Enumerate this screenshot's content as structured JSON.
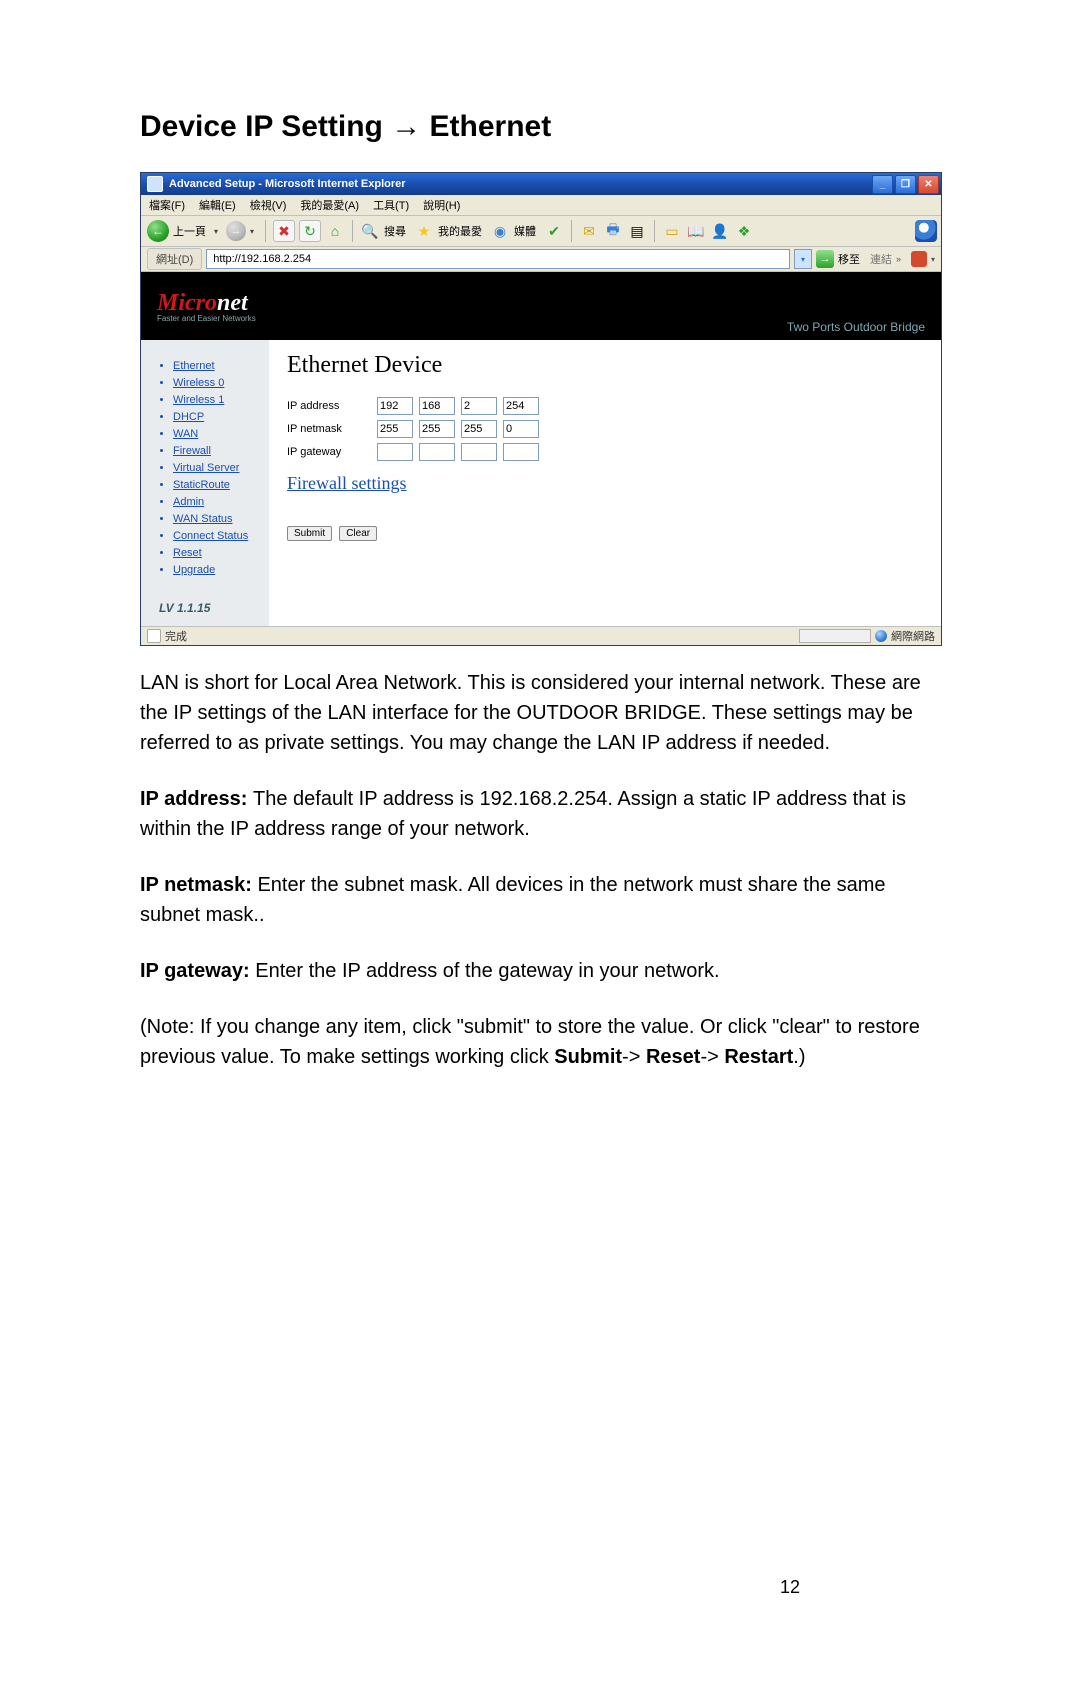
{
  "doc": {
    "heading": "Device IP Setting → Ethernet",
    "para1": "LAN is short for Local Area Network. This is considered your internal network. These are the IP settings of the LAN interface for the OUTDOOR BRIDGE. These settings may be referred to as private settings. You may change the LAN IP address if needed.",
    "ip_addr_lead": "IP address: ",
    "ip_addr_body": "The default IP address is 192.168.2.254. Assign a static IP address that is within the IP address range of your network.",
    "ip_mask_lead": "IP netmask: ",
    "ip_mask_body": "Enter the subnet mask. All devices in the network must share the same subnet mask..",
    "ip_gw_lead": "IP gateway: ",
    "ip_gw_body": "Enter the IP address of the gateway in your network.",
    "note_a": "(Note: If you change any item, click \"submit\" to store the value. Or click \"clear\" to restore previous value. To make settings working click ",
    "note_submit": "Submit",
    "note_b": "-> ",
    "note_reset": "Reset",
    "note_c": "-> ",
    "note_restart": "Restart",
    "note_d": ".)",
    "page_number": "12"
  },
  "ie": {
    "title": "Advanced Setup - Microsoft Internet Explorer",
    "menus": [
      "檔案(F)",
      "編輯(E)",
      "檢視(V)",
      "我的最愛(A)",
      "工具(T)",
      "說明(H)"
    ],
    "back_label": "上一頁",
    "search_label": "搜尋",
    "fav_label": "我的最愛",
    "media_label": "媒體",
    "addr_label": "網址(D)",
    "url": "http://192.168.2.254",
    "go_label": "移至",
    "links_label": "連結",
    "status_done": "完成",
    "status_zone": "網際網路"
  },
  "app": {
    "brand_prefix": "Micro",
    "brand_suffix": "net",
    "brand_sub": "Faster and Easier Networks",
    "brand_right": "Two Ports Outdoor Bridge",
    "nav": {
      "items": [
        "Ethernet",
        "Wireless 0",
        "Wireless 1",
        "DHCP",
        "WAN",
        "Firewall",
        "Virtual Server",
        "StaticRoute",
        "Admin",
        "WAN Status",
        "Connect Status",
        "Reset",
        "Upgrade"
      ],
      "version": "LV 1.1.15"
    },
    "main": {
      "title": "Ethernet Device",
      "rows": {
        "ip_label": "IP address",
        "ip": [
          "192",
          "168",
          "2",
          "254"
        ],
        "mask_label": "IP netmask",
        "mask": [
          "255",
          "255",
          "255",
          "0"
        ],
        "gw_label": "IP gateway",
        "gw": [
          "",
          "",
          "",
          ""
        ]
      },
      "fw_link": "Firewall settings",
      "submit": "Submit",
      "clear": "Clear"
    }
  }
}
